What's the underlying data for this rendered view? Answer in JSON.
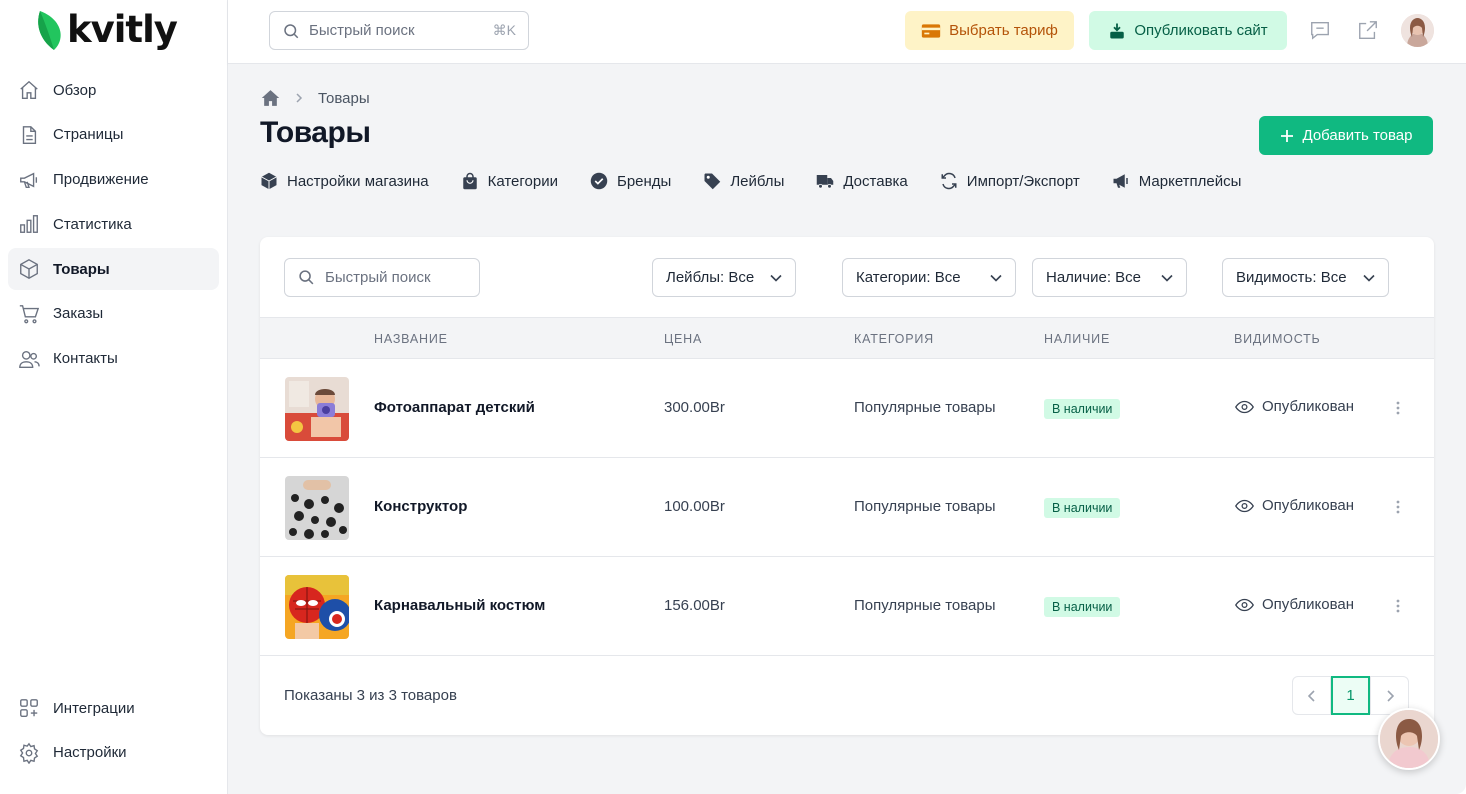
{
  "app": {
    "logo_text": "kvitly"
  },
  "sidebar": {
    "items": [
      {
        "label": "Обзор",
        "icon": "home-icon"
      },
      {
        "label": "Страницы",
        "icon": "document-icon"
      },
      {
        "label": "Продвижение",
        "icon": "megaphone-icon"
      },
      {
        "label": "Статистика",
        "icon": "bar-chart-icon"
      },
      {
        "label": "Товары",
        "icon": "cube-icon",
        "active": true
      },
      {
        "label": "Заказы",
        "icon": "cart-icon"
      },
      {
        "label": "Контакты",
        "icon": "users-icon"
      }
    ],
    "bottom": [
      {
        "label": "Интеграции",
        "icon": "apps-add-icon"
      },
      {
        "label": "Настройки",
        "icon": "gear-icon"
      }
    ]
  },
  "topbar": {
    "search_placeholder": "Быстрый поиск",
    "search_shortcut": "⌘K",
    "tariff_label": "Выбрать тариф",
    "publish_label": "Опубликовать сайт"
  },
  "breadcrumb": {
    "current": "Товары"
  },
  "page": {
    "title": "Товары",
    "add_label": "Добавить товар"
  },
  "subnav": [
    {
      "label": "Настройки магазина",
      "icon": "cube-icon"
    },
    {
      "label": "Категории",
      "icon": "shopping-bag-icon"
    },
    {
      "label": "Бренды",
      "icon": "badge-check-icon"
    },
    {
      "label": "Лейблы",
      "icon": "tag-icon"
    },
    {
      "label": "Доставка",
      "icon": "truck-icon"
    },
    {
      "label": "Импорт/Экспорт",
      "icon": "refresh-icon"
    },
    {
      "label": "Маркетплейсы",
      "icon": "megaphone-icon"
    }
  ],
  "filters": {
    "search_placeholder": "Быстрый поиск",
    "labels": "Лейблы: Все",
    "categories": "Категории: Все",
    "availability": "Наличие: Все",
    "visibility": "Видимость: Все"
  },
  "table": {
    "headers": {
      "name": "НАЗВАНИЕ",
      "price": "ЦЕНА",
      "category": "КАТЕГОРИЯ",
      "availability": "НАЛИЧИЕ",
      "visibility": "ВИДИМОСТЬ"
    },
    "rows": [
      {
        "name": "Фотоаппарат детский",
        "price": "300.00Br",
        "category": "Популярные товары",
        "availability": "В наличии",
        "visibility": "Опубликован"
      },
      {
        "name": "Конструктор",
        "price": "100.00Br",
        "category": "Популярные товары",
        "availability": "В наличии",
        "visibility": "Опубликован"
      },
      {
        "name": "Карнавальный костюм",
        "price": "156.00Br",
        "category": "Популярные товары",
        "availability": "В наличии",
        "visibility": "Опубликован"
      }
    ]
  },
  "footer": {
    "summary": "Показаны 3 из 3 товаров",
    "current_page": "1"
  },
  "colors": {
    "accent": "#10b981",
    "tariff_bg": "#fef3c7",
    "publish_bg": "#d1fae5"
  }
}
